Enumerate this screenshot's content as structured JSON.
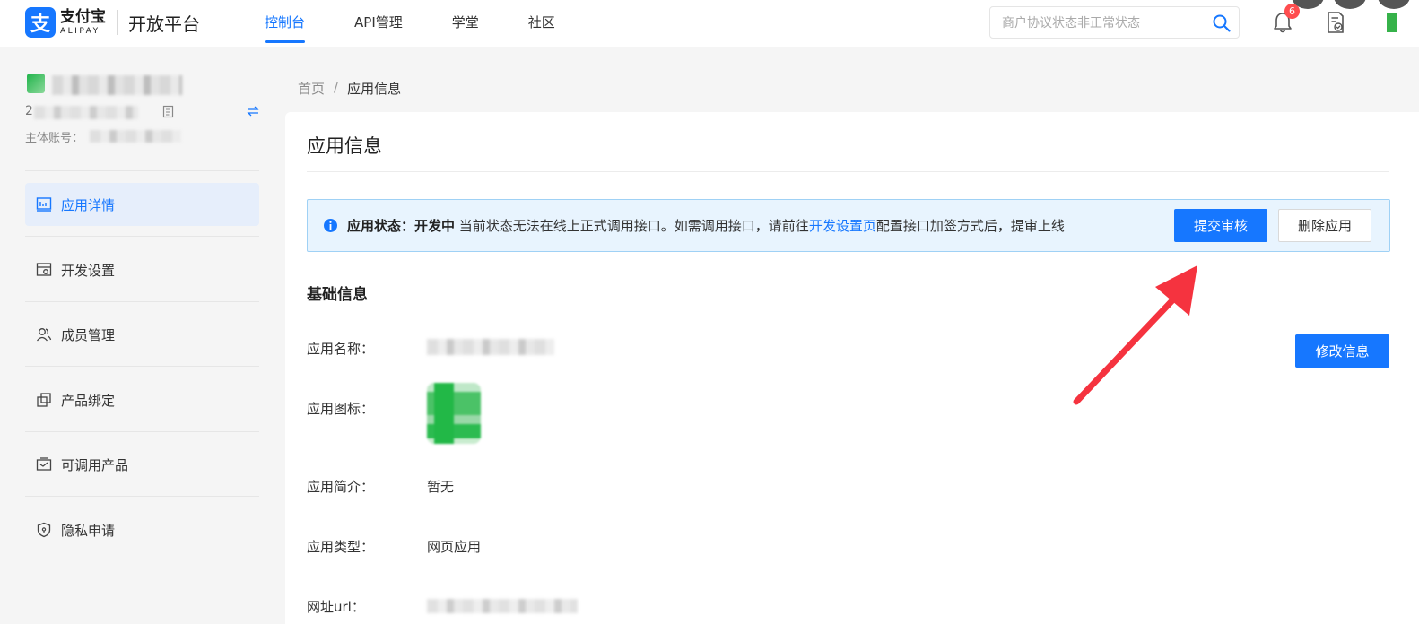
{
  "header": {
    "logo_cn": "支付宝",
    "logo_en": "ALIPAY",
    "logo_mark": "支",
    "platform": "开放平台",
    "nav": [
      "控制台",
      "API管理",
      "学堂",
      "社区"
    ],
    "active_nav": "控制台",
    "search_placeholder": "商户协议状态非正常状态",
    "notification_count": "6"
  },
  "sidebar": {
    "app_id": "2",
    "account_label": "主体账号：",
    "menu": [
      {
        "label": "应用详情",
        "icon": "app-detail-icon",
        "active": true
      },
      {
        "label": "开发设置",
        "icon": "dev-settings-icon",
        "active": false
      },
      {
        "label": "成员管理",
        "icon": "members-icon",
        "active": false
      },
      {
        "label": "产品绑定",
        "icon": "product-bind-icon",
        "active": false
      },
      {
        "label": "可调用产品",
        "icon": "callable-products-icon",
        "active": false
      },
      {
        "label": "隐私申请",
        "icon": "privacy-shield-icon",
        "active": false
      }
    ]
  },
  "breadcrumb": {
    "home": "首页",
    "separator": "/",
    "current": "应用信息"
  },
  "main": {
    "title": "应用信息",
    "alert": {
      "label": "应用状态：",
      "status": "开发中",
      "text_before": " 当前状态无法在线上正式调用接口。如需调用接口，请前往",
      "link": "开发设置页",
      "text_after": "配置接口加签方式后，提审上线"
    },
    "submit_button": "提交审核",
    "delete_button": "删除应用",
    "section_title": "基础信息",
    "edit_button": "修改信息",
    "fields": {
      "name_label": "应用名称：",
      "icon_label": "应用图标：",
      "intro_label": "应用简介：",
      "intro_value": "暂无",
      "type_label": "应用类型：",
      "type_value": "网页应用",
      "url_label": "网址url："
    }
  },
  "colors": {
    "primary": "#1677ff",
    "alert_bg": "#e8f4fe",
    "arrow": "#f5333f",
    "badge": "#ff4d4f"
  }
}
